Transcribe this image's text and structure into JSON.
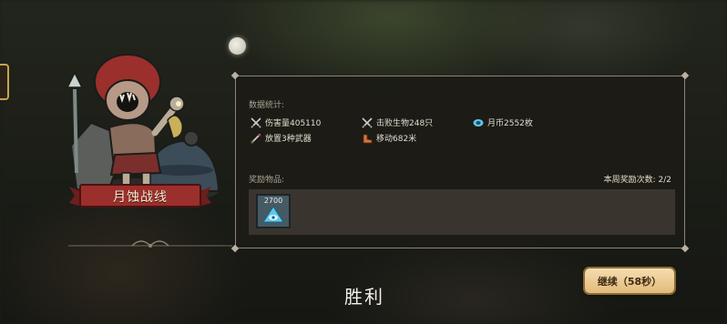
{
  "stage": {
    "name": "月蚀战线"
  },
  "stats": {
    "section_title": "数据统计:",
    "items": [
      {
        "icon": "crossed-swords-icon",
        "text": "伤害量405110"
      },
      {
        "icon": "crossed-swords-icon",
        "text": "击败生物248只"
      },
      {
        "icon": "moon-coin-icon",
        "text": "月币2552枚"
      },
      {
        "icon": "weapon-icon",
        "text": "放置3种武器"
      },
      {
        "icon": "boot-icon",
        "text": "移动682米"
      }
    ]
  },
  "rewards": {
    "section_title": "奖励物品:",
    "weekly_count": "本周奖励次数: 2/2",
    "items": [
      {
        "icon": "moon-coin-icon",
        "amount": "2700"
      }
    ]
  },
  "result": {
    "title": "胜利"
  },
  "continue_button": {
    "label": "继续（58秒）"
  },
  "colors": {
    "panel_border": "#8c8576",
    "ribbon": "#9b2f2c",
    "button": "#e8c48a"
  }
}
